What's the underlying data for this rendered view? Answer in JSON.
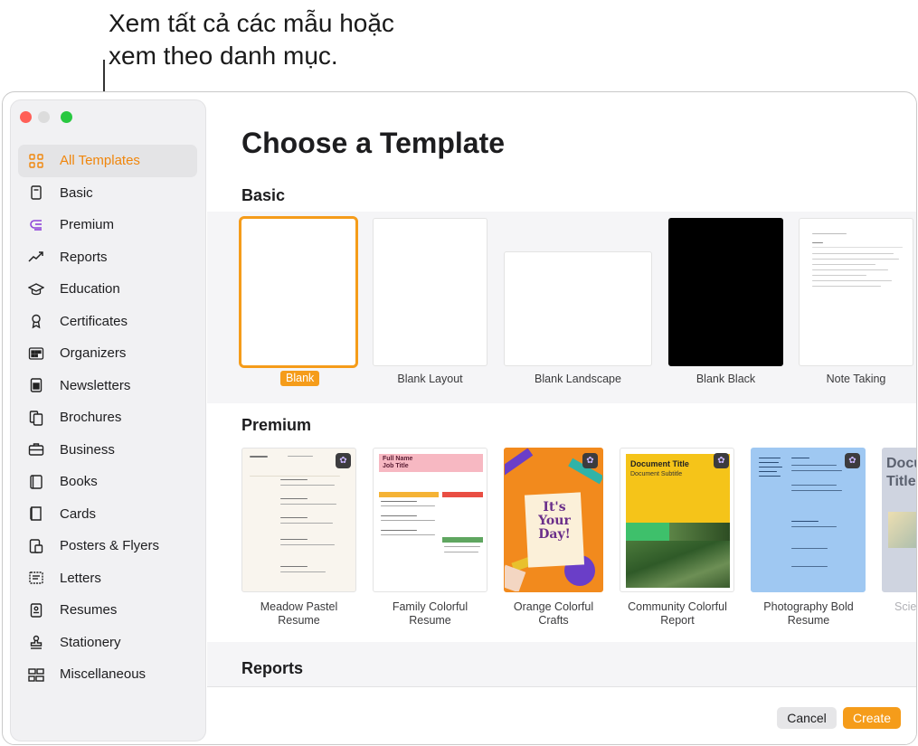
{
  "callout": {
    "line1": "Xem tất cả các mẫu hoặc",
    "line2": "xem theo danh mục."
  },
  "sidebar": {
    "items": [
      {
        "label": "All Templates",
        "icon": "grid-icon",
        "active": true
      },
      {
        "label": "Basic",
        "icon": "document-icon"
      },
      {
        "label": "Premium",
        "icon": "premium-icon"
      },
      {
        "label": "Reports",
        "icon": "trend-chart-icon"
      },
      {
        "label": "Education",
        "icon": "graduation-cap-icon"
      },
      {
        "label": "Certificates",
        "icon": "ribbon-icon"
      },
      {
        "label": "Organizers",
        "icon": "calendar-grid-icon"
      },
      {
        "label": "Newsletters",
        "icon": "newsletter-icon"
      },
      {
        "label": "Brochures",
        "icon": "brochure-icon"
      },
      {
        "label": "Business",
        "icon": "briefcase-icon"
      },
      {
        "label": "Books",
        "icon": "book-icon"
      },
      {
        "label": "Cards",
        "icon": "card-icon"
      },
      {
        "label": "Posters & Flyers",
        "icon": "poster-icon"
      },
      {
        "label": "Letters",
        "icon": "letter-icon"
      },
      {
        "label": "Resumes",
        "icon": "resume-icon"
      },
      {
        "label": "Stationery",
        "icon": "stamp-icon"
      },
      {
        "label": "Miscellaneous",
        "icon": "shapes-icon"
      }
    ]
  },
  "main": {
    "title": "Choose a Template",
    "sections": {
      "basic": {
        "title": "Basic",
        "templates": [
          {
            "label": "Blank"
          },
          {
            "label": "Blank Layout"
          },
          {
            "label": "Blank Landscape"
          },
          {
            "label": "Blank Black"
          },
          {
            "label": "Note Taking"
          }
        ]
      },
      "premium": {
        "title": "Premium",
        "templates": [
          {
            "label1": "Meadow Pastel",
            "label2": "Resume"
          },
          {
            "label1": "Family Colorful",
            "label2": "Resume"
          },
          {
            "label1": "Orange Colorful",
            "label2": "Crafts"
          },
          {
            "label1": "Community Colorful",
            "label2": "Report"
          },
          {
            "label1": "Photography Bold",
            "label2": "Resume"
          },
          {
            "label1": "Scie",
            "label2": ""
          }
        ]
      },
      "reports": {
        "title": "Reports"
      }
    },
    "thumb_text": {
      "family_name": "Full Name",
      "family_job": "Job Title",
      "crafts_line1": "It's",
      "crafts_line2": "Your",
      "crafts_line3": "Day!",
      "report_title": "Document Title",
      "report_subtitle": "Document Subtitle",
      "partial_title1": "Docu",
      "partial_title2": "Title"
    }
  },
  "footer": {
    "cancel_label": "Cancel",
    "create_label": "Create"
  },
  "colors": {
    "accent": "#f59c1a",
    "sidebar_active_text": "#f0860c"
  }
}
